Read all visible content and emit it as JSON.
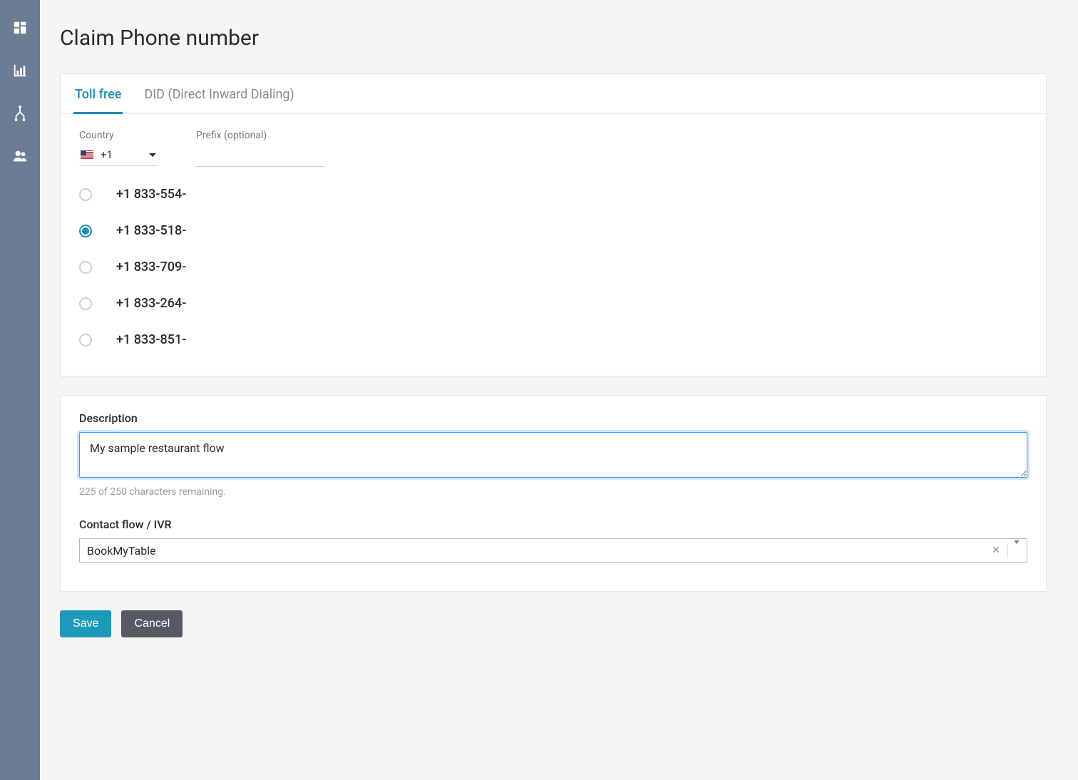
{
  "sidebar": {
    "items": [
      {
        "name": "dashboard-icon"
      },
      {
        "name": "metrics-icon"
      },
      {
        "name": "routing-icon"
      },
      {
        "name": "users-icon"
      }
    ]
  },
  "header": {
    "title": "Claim Phone number"
  },
  "tabs": {
    "items": [
      {
        "label": "Toll free",
        "active": true
      },
      {
        "label": "DID (Direct Inward Dialing)",
        "active": false
      }
    ]
  },
  "country": {
    "label": "Country",
    "code": "+1"
  },
  "prefix": {
    "label": "Prefix (optional)",
    "value": ""
  },
  "phoneNumbers": {
    "selectedIndex": 1,
    "items": [
      "+1 833-554-",
      "+1 833-518-",
      "+1 833-709-",
      "+1 833-264-",
      "+1 833-851-"
    ]
  },
  "description": {
    "label": "Description",
    "value": "My sample restaurant flow",
    "helper": "225 of 250 characters remaining."
  },
  "contactFlow": {
    "label": "Contact flow / IVR",
    "selected": "BookMyTable"
  },
  "actions": {
    "save": "Save",
    "cancel": "Cancel"
  }
}
